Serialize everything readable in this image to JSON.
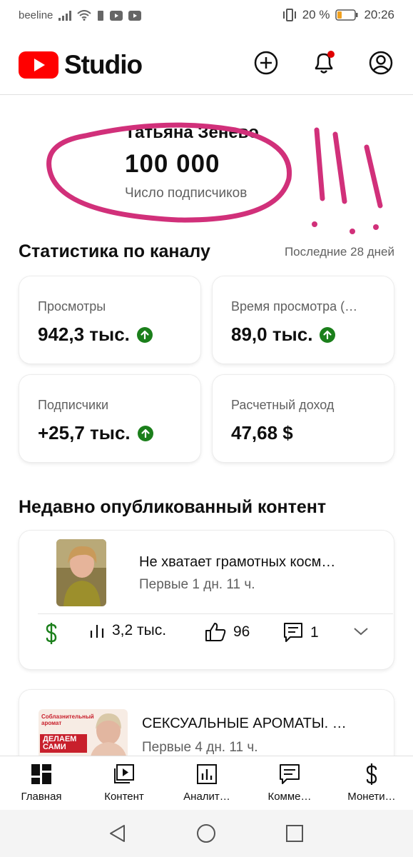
{
  "status_bar": {
    "carrier": "beeline",
    "battery_percent": "20 %",
    "time": "20:26",
    "icons": [
      "signal-icon",
      "wifi-icon",
      "sim-icon",
      "youtube-notification-icon",
      "youtube-notification-icon",
      "vibrate-icon",
      "battery-icon"
    ]
  },
  "header": {
    "logo_text": "Studio",
    "brand_color": "#ff0000",
    "actions": [
      "create-icon",
      "notifications-icon",
      "account-icon"
    ]
  },
  "channel": {
    "name": "Татьяна Зенево",
    "subscribers": "100 000",
    "subscribers_label": "Число подписчиков"
  },
  "stats": {
    "title": "Статистика по каналу",
    "period": "Последние 28 дней",
    "cards": [
      {
        "label": "Просмотры",
        "value": "942,3 тыс.",
        "trend": "up"
      },
      {
        "label": "Время просмотра (…",
        "value": "89,0 тыс.",
        "trend": "up"
      },
      {
        "label": "Подписчики",
        "value": "+25,7 тыс.",
        "trend": "up"
      },
      {
        "label": "Расчетный доход",
        "value": "47,68 $",
        "trend": "none"
      }
    ],
    "trend_color": "#1b7f1b"
  },
  "recent": {
    "title": "Недавно опубликованный контент",
    "videos": [
      {
        "title": "Не хватает грамотных косм…",
        "period": "Первые 1 дн. 11 ч.",
        "views": "3,2 тыс.",
        "likes": "96",
        "comments": "1"
      },
      {
        "title": "СЕКСУАЛЬНЫЕ АРОМАТЫ. …",
        "period": "Первые 4 дн. 11 ч.",
        "thumb_text": [
          "Соблазнительный",
          "аромат",
          "ДЕЛАЕМ",
          "САМИ"
        ]
      }
    ]
  },
  "bottom_nav": [
    {
      "label": "Главная",
      "icon": "dashboard-icon"
    },
    {
      "label": "Контент",
      "icon": "content-icon"
    },
    {
      "label": "Аналит…",
      "icon": "analytics-icon"
    },
    {
      "label": "Комме…",
      "icon": "comments-icon"
    },
    {
      "label": "Монети…",
      "icon": "monetization-icon"
    }
  ],
  "system_nav": [
    "back-icon",
    "home-icon",
    "recents-icon"
  ]
}
